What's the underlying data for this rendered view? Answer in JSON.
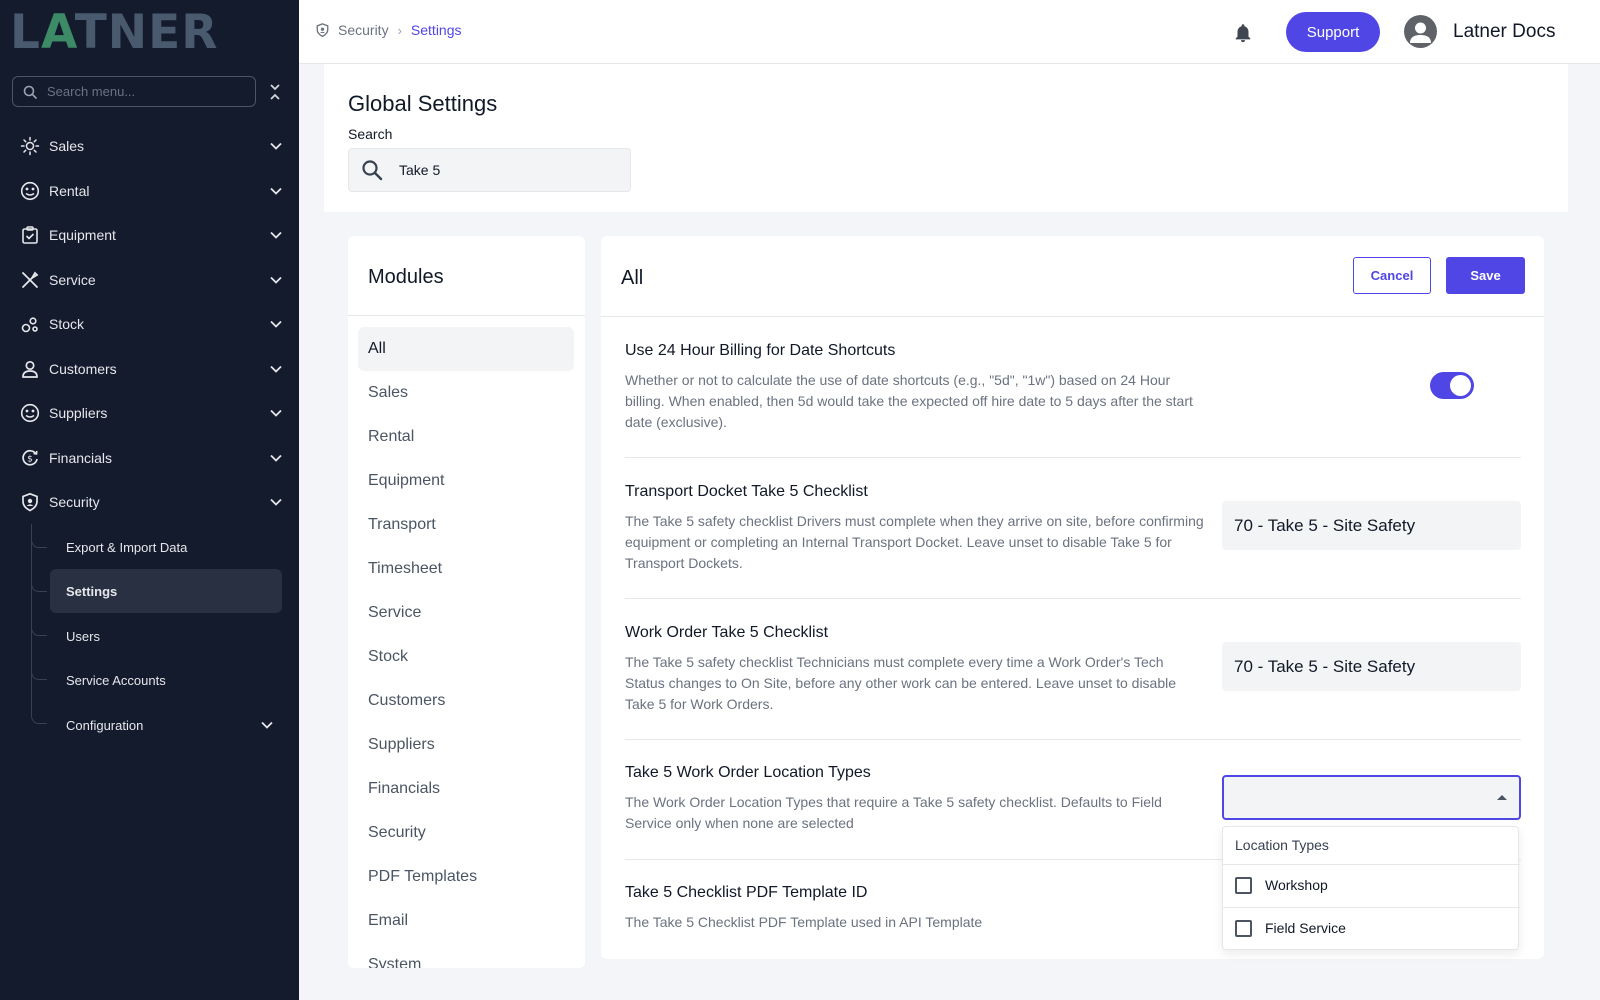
{
  "brand": {
    "logo_text_pre": "L",
    "logo_text_a": "A",
    "logo_text_post": "TNER"
  },
  "sidebar": {
    "search_placeholder": "Search menu...",
    "items": [
      {
        "label": "Sales",
        "icon": "sales-icon"
      },
      {
        "label": "Rental",
        "icon": "rental-icon"
      },
      {
        "label": "Equipment",
        "icon": "equipment-icon"
      },
      {
        "label": "Service",
        "icon": "tools-icon"
      },
      {
        "label": "Stock",
        "icon": "stock-icon"
      },
      {
        "label": "Customers",
        "icon": "person-icon"
      },
      {
        "label": "Suppliers",
        "icon": "suppliers-icon"
      },
      {
        "label": "Financials",
        "icon": "financials-icon"
      },
      {
        "label": "Security",
        "icon": "shield-icon"
      }
    ],
    "security_children": [
      {
        "label": "Export & Import Data"
      },
      {
        "label": "Settings",
        "active": true
      },
      {
        "label": "Users"
      },
      {
        "label": "Service Accounts"
      },
      {
        "label": "Configuration"
      }
    ]
  },
  "header": {
    "breadcrumb": {
      "section": "Security",
      "current": "Settings"
    },
    "support_label": "Support",
    "user_name": "Latner Docs"
  },
  "global_settings": {
    "title": "Global Settings",
    "search_label": "Search",
    "search_value": "Take 5"
  },
  "modules": {
    "title": "Modules",
    "items": [
      "All",
      "Sales",
      "Rental",
      "Equipment",
      "Transport",
      "Timesheet",
      "Service",
      "Stock",
      "Customers",
      "Suppliers",
      "Financials",
      "Security",
      "PDF Templates",
      "Email",
      "System"
    ],
    "active": "All"
  },
  "settings": {
    "title": "All",
    "cancel_label": "Cancel",
    "save_label": "Save",
    "rows": [
      {
        "title": "Use 24 Hour Billing for Date Shortcuts",
        "description": "Whether or not to calculate the use of date shortcuts (e.g., \"5d\", \"1w\") based on 24 Hour billing. When enabled, then 5d would take the expected off hire date to 5 days after the start date (exclusive).",
        "control": "toggle",
        "enabled": true
      },
      {
        "title": "Transport Docket Take 5 Checklist",
        "description": "The Take 5 safety checklist Drivers must complete when they arrive on site, before confirming equipment or completing an Internal Transport Docket. Leave unset to disable Take 5 for Transport Dockets.",
        "control": "select",
        "value": "70 - Take 5 - Site Safety"
      },
      {
        "title": "Work Order Take 5 Checklist",
        "description": "The Take 5 safety checklist Technicians must complete every time a Work Order's Tech Status changes to On Site, before any other work can be entered. Leave unset to disable Take 5 for Work Orders.",
        "control": "select",
        "value": "70 - Take 5 - Site Safety"
      },
      {
        "title": "Take 5 Work Order Location Types",
        "description": "The Work Order Location Types that require a Take 5 safety checklist. Defaults to Field Service only when none are selected",
        "control": "multiselect",
        "value": ""
      },
      {
        "title": "Take 5 Checklist PDF Template ID",
        "description": "The Take 5 Checklist PDF Template used in API Template",
        "control": "none"
      }
    ]
  },
  "dropdown": {
    "header": "Location Types",
    "options": [
      {
        "label": "Workshop",
        "checked": false
      },
      {
        "label": "Field Service",
        "checked": false
      }
    ]
  },
  "colors": {
    "accent": "#4f46e5",
    "sidebar_bg": "#141b2d",
    "page_bg": "#f4f5f9"
  }
}
